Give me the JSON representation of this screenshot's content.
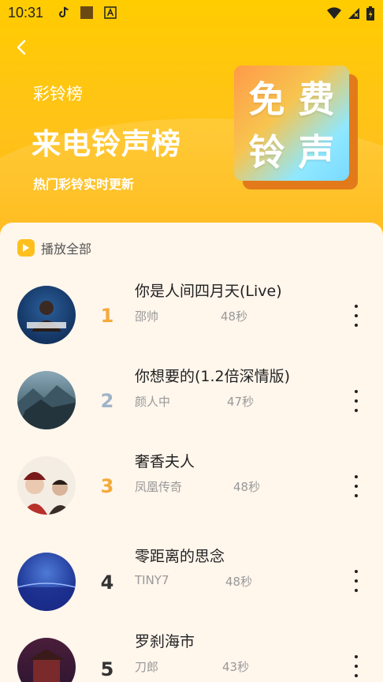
{
  "status_bar": {
    "time": "10:31",
    "icons": [
      "tiktok-icon",
      "square-icon",
      "a-icon"
    ],
    "right_icons": [
      "wifi-icon",
      "signal-icon",
      "battery-icon"
    ]
  },
  "header": {
    "category": "彩铃榜",
    "title": "来电铃声榜",
    "tagline": "热门彩铃实时更新",
    "badge_chars": [
      "免",
      "费",
      "铃",
      "声"
    ]
  },
  "list": {
    "play_all_label": "播放全部",
    "songs": [
      {
        "rank": "1",
        "title": "你是人间四月天(Live)",
        "singer": "邵帅",
        "duration": "48秒",
        "rank_color": "#f4a93a"
      },
      {
        "rank": "2",
        "title": "你想要的(1.2倍深情版)",
        "singer": "颜人中",
        "duration": "47秒",
        "rank_color": "#9fb3c8"
      },
      {
        "rank": "3",
        "title": "奢香夫人",
        "singer": "凤凰传奇",
        "duration": "48秒",
        "rank_color": "#f4a93a"
      },
      {
        "rank": "4",
        "title": "零距离的思念",
        "singer": "TINY7",
        "duration": "48秒",
        "rank_color": "#333333"
      },
      {
        "rank": "5",
        "title": "罗刹海市",
        "singer": "刀郎",
        "duration": "43秒",
        "rank_color": "#333333"
      }
    ]
  },
  "colors": {
    "header_yellow": "#ffc400",
    "accent": "#ffc01e"
  }
}
